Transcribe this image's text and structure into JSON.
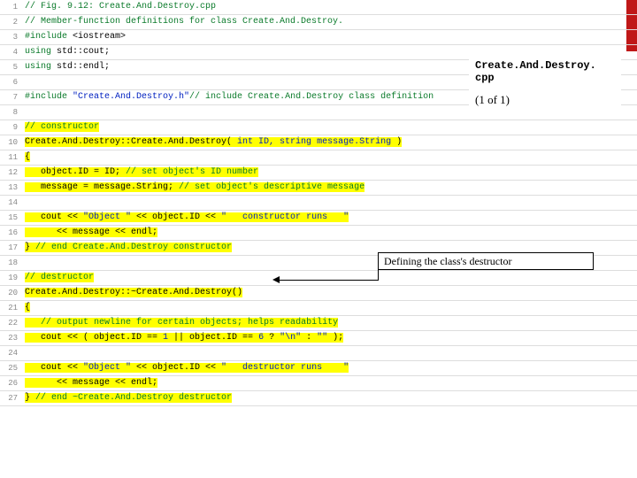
{
  "info": {
    "title_l1": "Create.And.Destroy.",
    "title_l2": "cpp",
    "page": "(1 of 1)"
  },
  "callout": {
    "text": "Defining the class's destructor"
  },
  "lines": [
    {
      "n": "1",
      "hl": false,
      "segs": [
        [
          "// Fig. 9.12: Create.And.Destroy.cpp",
          "c-comment"
        ]
      ]
    },
    {
      "n": "2",
      "hl": false,
      "segs": [
        [
          "// Member-function definitions for class Create.And.Destroy.",
          "c-comment"
        ]
      ]
    },
    {
      "n": "3",
      "hl": false,
      "segs": [
        [
          "#include ",
          "c-pre"
        ],
        [
          "<iostream>",
          "c-id"
        ]
      ]
    },
    {
      "n": "4",
      "hl": false,
      "segs": [
        [
          "using",
          "c-pre"
        ],
        [
          " std::cout;",
          "c-id"
        ]
      ]
    },
    {
      "n": "5",
      "hl": false,
      "segs": [
        [
          "using",
          "c-pre"
        ],
        [
          " std::endl;",
          "c-id"
        ]
      ]
    },
    {
      "n": "6",
      "hl": false,
      "segs": [
        [
          "",
          "c-id"
        ]
      ]
    },
    {
      "n": "7",
      "hl": false,
      "segs": [
        [
          "#include ",
          "c-pre"
        ],
        [
          "\"Create.And.Destroy.h\"",
          "c-str"
        ],
        [
          "// include Create.And.Destroy class definition",
          "c-comment"
        ]
      ]
    },
    {
      "n": "8",
      "hl": false,
      "segs": [
        [
          "",
          "c-id"
        ]
      ]
    },
    {
      "n": "9",
      "hl": true,
      "segs": [
        [
          "// constructor",
          "c-comment"
        ]
      ]
    },
    {
      "n": "10",
      "hl": true,
      "segs": [
        [
          "Create.And.Destroy::Create.And.Destroy(",
          "c-id"
        ],
        [
          " int ID, string message.String ",
          "c-str"
        ],
        [
          ")",
          "c-id"
        ]
      ]
    },
    {
      "n": "11",
      "hl": true,
      "segs": [
        [
          "{",
          "c-id"
        ]
      ]
    },
    {
      "n": "12",
      "hl": true,
      "segs": [
        [
          "   object.ID = ID; ",
          "c-id"
        ],
        [
          "// set object's ID number",
          "c-comment"
        ]
      ]
    },
    {
      "n": "13",
      "hl": true,
      "segs": [
        [
          "   message = message.String; ",
          "c-id"
        ],
        [
          "// set object's descriptive message",
          "c-comment"
        ]
      ]
    },
    {
      "n": "14",
      "hl": false,
      "segs": [
        [
          "",
          "c-id"
        ]
      ]
    },
    {
      "n": "15",
      "hl": true,
      "segs": [
        [
          "   cout << ",
          "c-id"
        ],
        [
          "\"Object \" ",
          "c-str"
        ],
        [
          "<< object.ID << ",
          "c-id"
        ],
        [
          "\"   constructor runs   \"",
          "c-str"
        ]
      ]
    },
    {
      "n": "16",
      "hl": true,
      "segs": [
        [
          "      << message << endl;",
          "c-id"
        ]
      ]
    },
    {
      "n": "17",
      "hl": true,
      "segs": [
        [
          "} ",
          "c-id"
        ],
        [
          "// end Create.And.Destroy constructor",
          "c-comment"
        ]
      ]
    },
    {
      "n": "18",
      "hl": false,
      "segs": [
        [
          "",
          "c-id"
        ]
      ]
    },
    {
      "n": "19",
      "hl": true,
      "segs": [
        [
          "// destructor",
          "c-comment"
        ]
      ]
    },
    {
      "n": "20",
      "hl": true,
      "segs": [
        [
          "Create.And.Destroy::~Create.And.Destroy()",
          "c-id"
        ]
      ]
    },
    {
      "n": "21",
      "hl": true,
      "segs": [
        [
          "{",
          "c-id"
        ]
      ]
    },
    {
      "n": "22",
      "hl": true,
      "segs": [
        [
          "   ",
          "c-id"
        ],
        [
          "// output newline for certain objects; helps readability",
          "c-comment"
        ]
      ]
    },
    {
      "n": "23",
      "hl": true,
      "segs": [
        [
          "   cout << ( object.ID == ",
          "c-id"
        ],
        [
          "1 ",
          "c-str"
        ],
        [
          "|| object.ID == ",
          "c-id"
        ],
        [
          "6 ",
          "c-str"
        ],
        [
          "? ",
          "c-id"
        ],
        [
          "\"\\n\" ",
          "c-str"
        ],
        [
          ": ",
          "c-id"
        ],
        [
          "\"\" ",
          "c-str"
        ],
        [
          ");",
          "c-id"
        ]
      ]
    },
    {
      "n": "24",
      "hl": false,
      "segs": [
        [
          "",
          "c-id"
        ]
      ]
    },
    {
      "n": "25",
      "hl": true,
      "segs": [
        [
          "   cout << ",
          "c-id"
        ],
        [
          "\"Object \" ",
          "c-str"
        ],
        [
          "<< object.ID << ",
          "c-id"
        ],
        [
          "\"   destructor runs    \"",
          "c-str"
        ]
      ]
    },
    {
      "n": "26",
      "hl": true,
      "segs": [
        [
          "      << message << endl;",
          "c-id"
        ]
      ]
    },
    {
      "n": "27",
      "hl": true,
      "segs": [
        [
          "} ",
          "c-id"
        ],
        [
          "// end ~Create.And.Destroy destructor",
          "c-comment"
        ]
      ]
    }
  ]
}
